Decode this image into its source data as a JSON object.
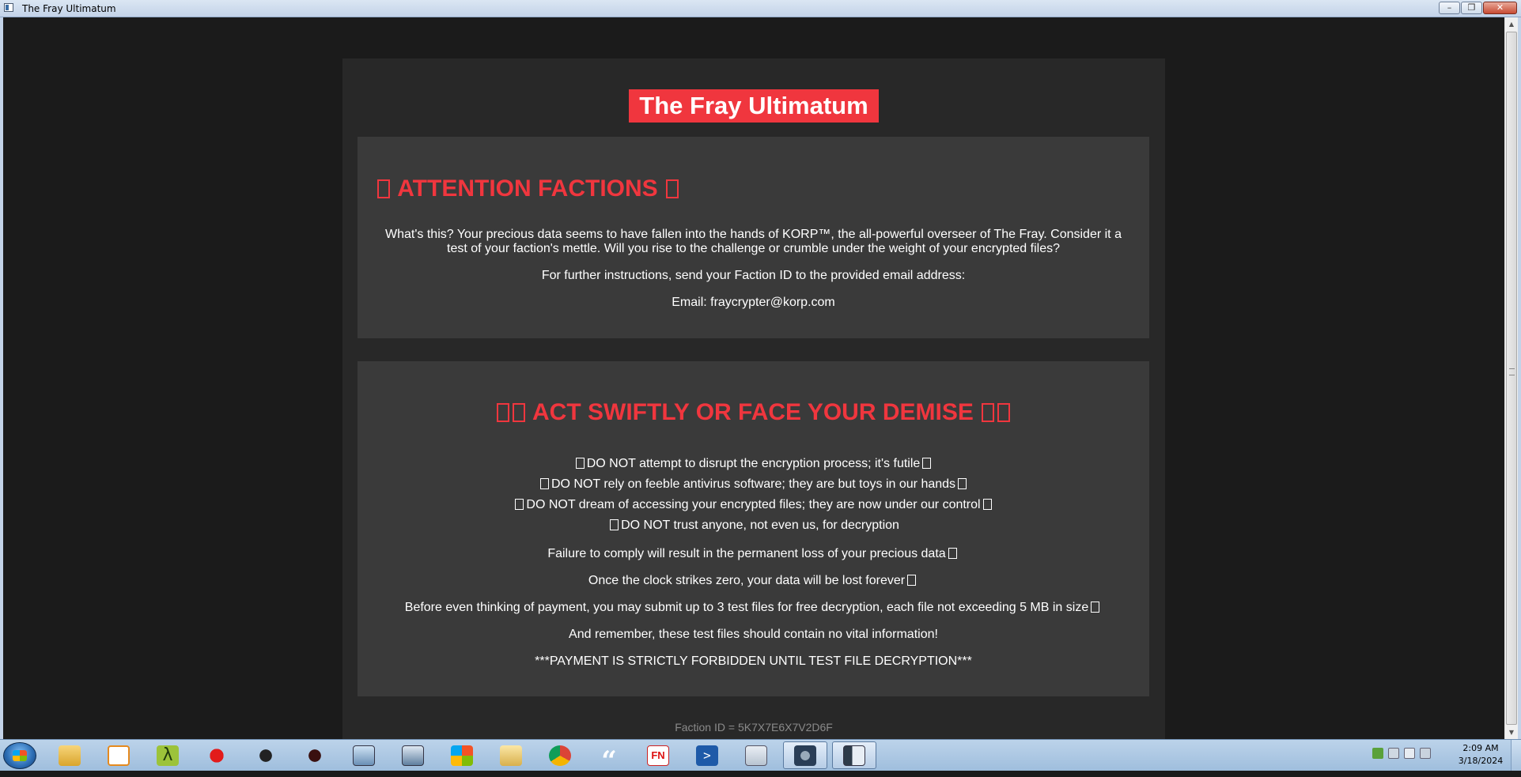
{
  "window": {
    "title": "The Fray Ultimatum",
    "minimize": "–",
    "restore": "❐",
    "close": "✕"
  },
  "page": {
    "main_title": "The Fray Ultimatum",
    "attention": {
      "heading": "ATTENTION FACTIONS",
      "intro": "What's this? Your precious data seems to have fallen into the hands of KORP™, the all-powerful overseer of The Fray. Consider it a test of your faction's mettle. Will you rise to the challenge or crumble under the weight of your encrypted files?",
      "instructions": "For further instructions, send your Faction ID to the provided email address:",
      "email": "Email: fraycrypter@korp.com"
    },
    "act": {
      "heading": "ACT SWIFTLY OR FACE YOUR DEMISE",
      "warnings": [
        "DO NOT attempt to disrupt the encryption process; it's futile",
        "DO NOT rely on feeble antivirus software; they are but toys in our hands",
        "DO NOT dream of accessing your encrypted files; they are now under our control",
        "DO NOT trust anyone, not even us, for decryption"
      ],
      "failure": "Failure to comply will result in the permanent loss of your precious data",
      "clock": "Once the clock strikes zero, your data will be lost forever",
      "test_files": "Before even thinking of payment, you may submit up to 3 test files for free decryption, each file not exceeding 5 MB in size",
      "remember": "And remember, these test files should contain no vital information!",
      "forbidden": "***PAYMENT IS STRICTLY FORBIDDEN UNTIL TEST FILE DECRYPTION***"
    },
    "faction_id": "Faction ID = 5K7X7E6X7V2D6F"
  },
  "taskbar": {
    "items": [
      "explorer-icon",
      "media-player-icon",
      "lambda-icon",
      "red-splat-icon",
      "bug-icon",
      "bug-icon",
      "process-monitor-icon",
      "network-monitor-icon",
      "windows-logo-icon",
      "folder-window-icon",
      "chrome-icon",
      "quote-icon",
      "fn-icon",
      "powershell-icon",
      "calculator-icon",
      "disk-tool-icon",
      "ransom-window-icon"
    ],
    "fn_label": "FN",
    "clock_time": "2:09 AM",
    "clock_date": "3/18/2024"
  },
  "colors": {
    "accent_red": "#f0363e",
    "panel": "#3a3a3a",
    "container": "#282828",
    "background": "#1b1b1b"
  }
}
